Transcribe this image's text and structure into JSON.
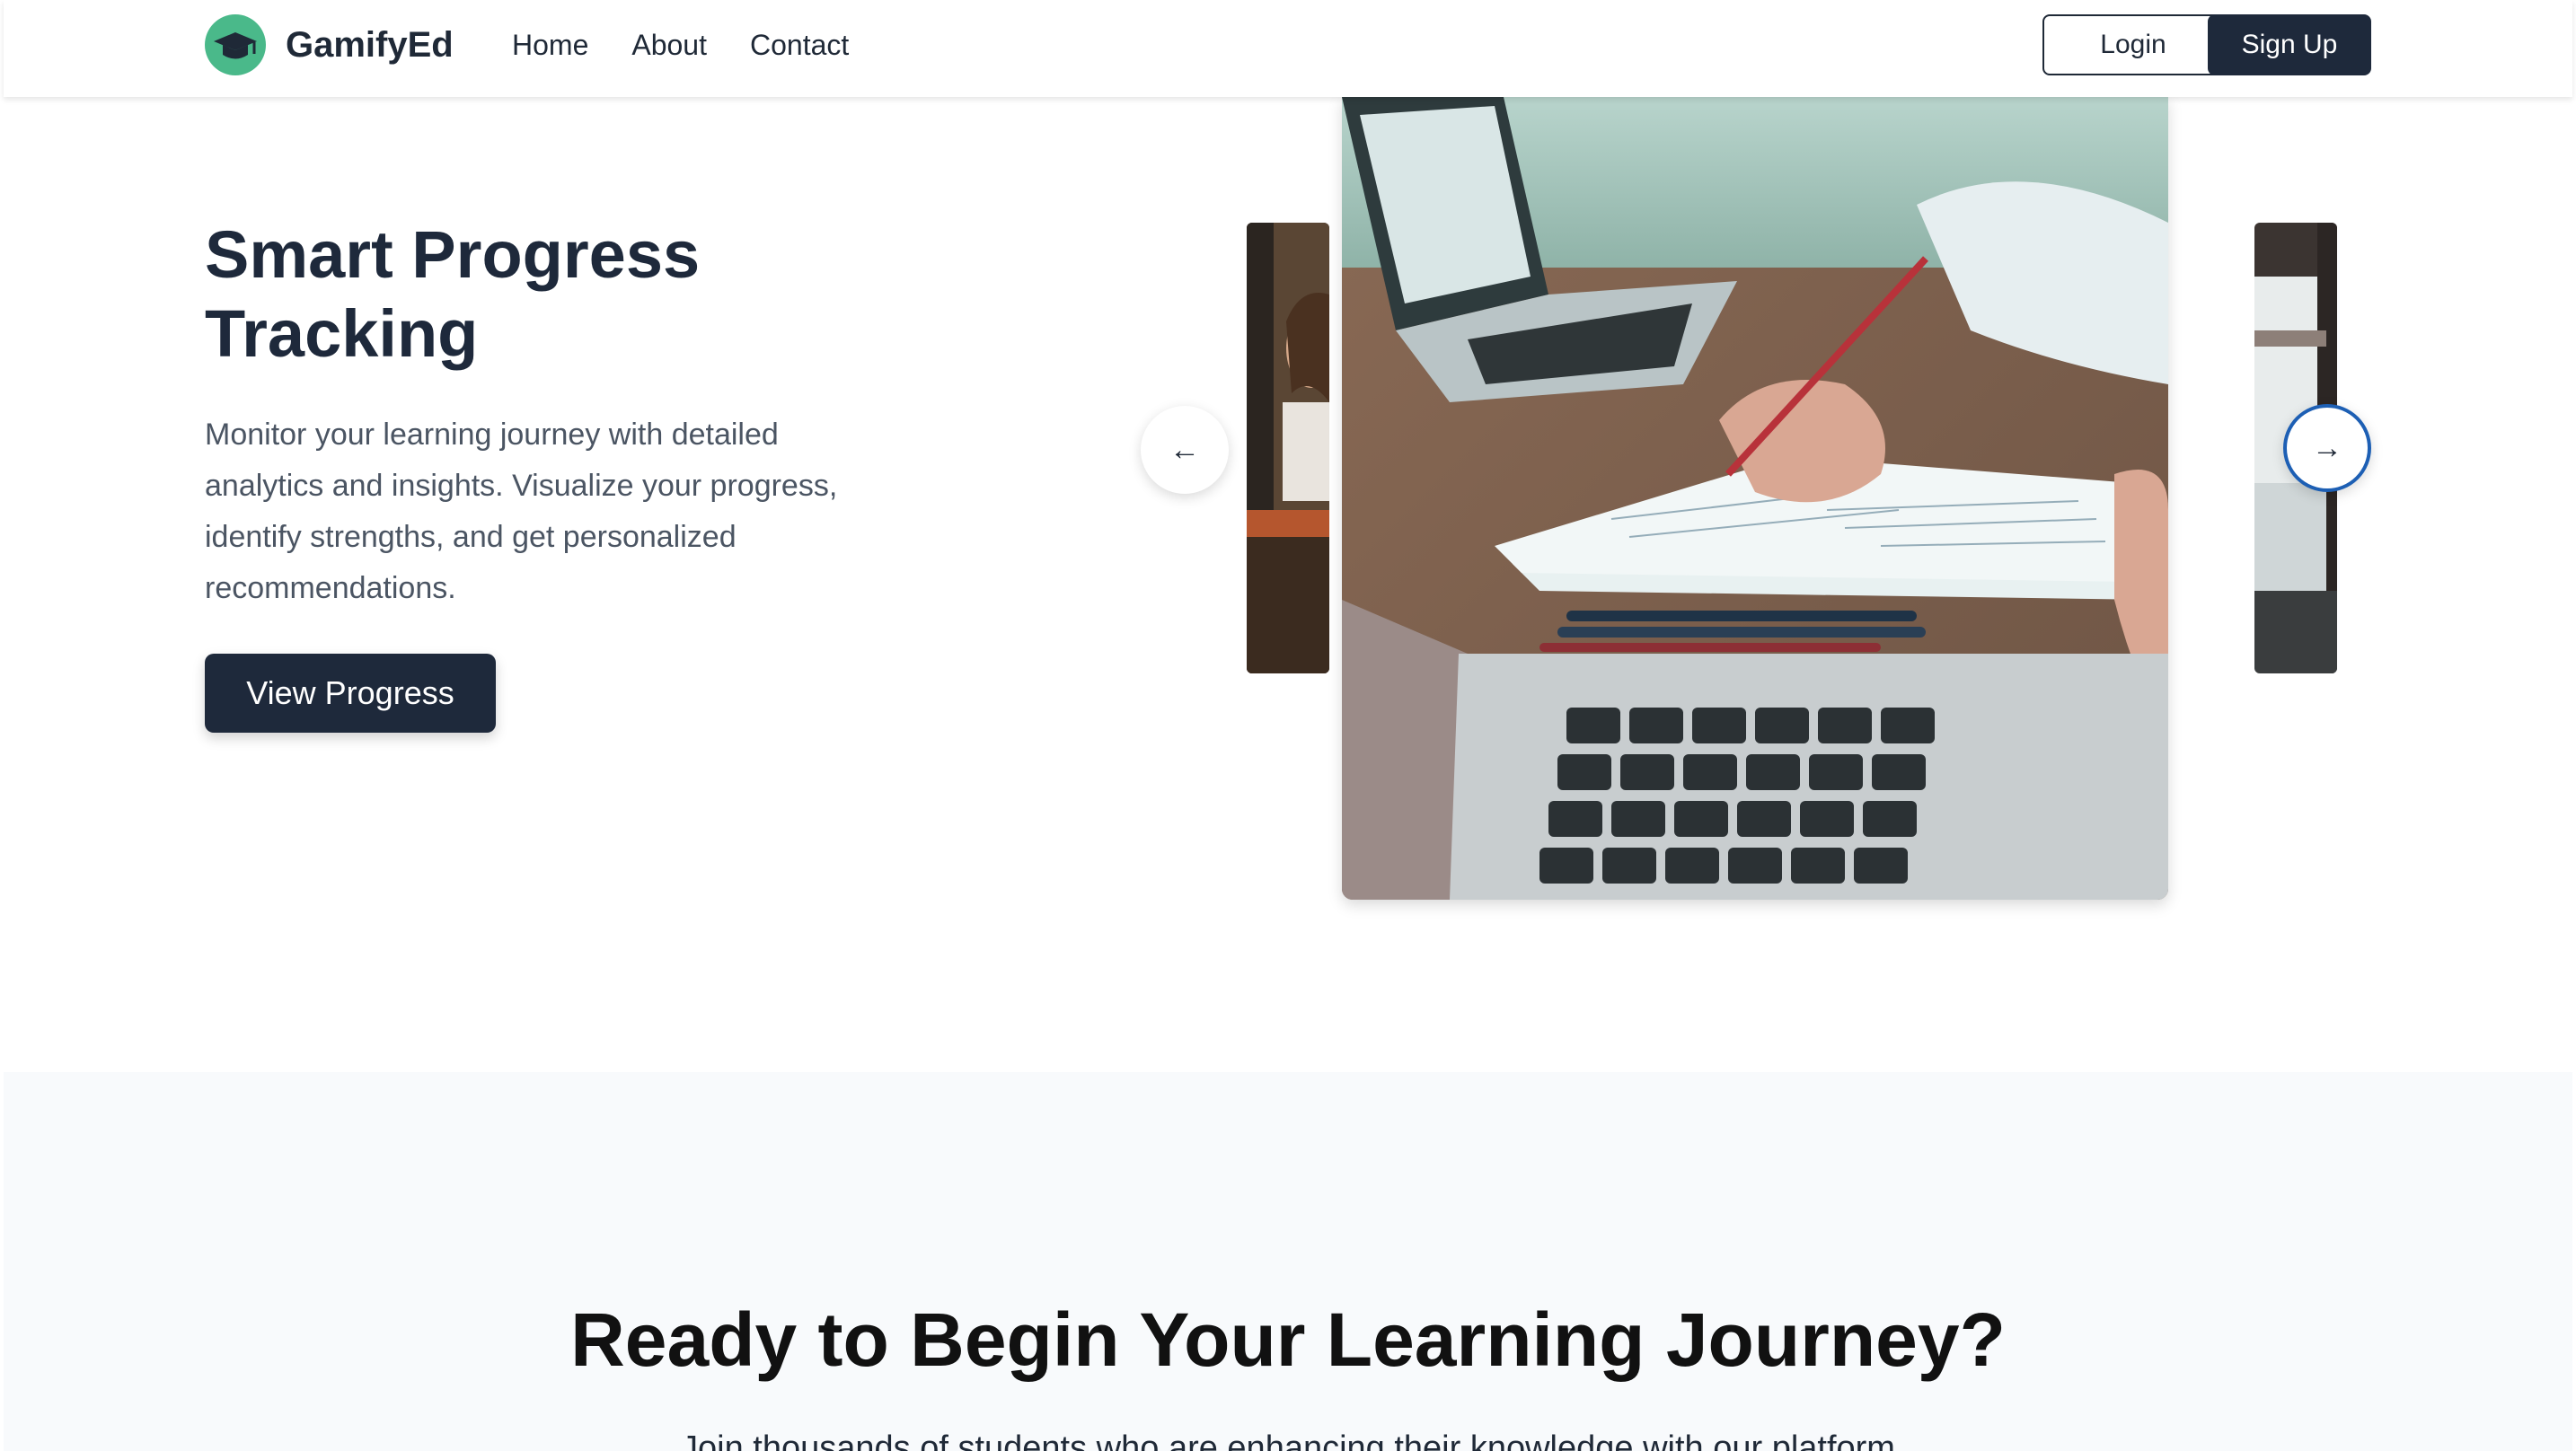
{
  "nav": {
    "brand": "GamifyEd",
    "links": [
      {
        "label": "Home"
      },
      {
        "label": "About"
      },
      {
        "label": "Contact"
      }
    ],
    "login_label": "Login",
    "signup_label": "Sign Up"
  },
  "hero": {
    "title_line1": "Smart Progress",
    "title_line2": "Tracking",
    "description": "Monitor your learning journey with detailed analytics and insights. Visualize your progress, identify strengths, and get personalized recommendations.",
    "cta_label": "View Progress"
  },
  "carousel": {
    "prev_arrow": "←",
    "next_arrow": "→"
  },
  "cta": {
    "title": "Ready to Begin Your Learning Journey?",
    "subtitle": "Join thousands of students who are enhancing their knowledge with our platform"
  },
  "colors": {
    "primary": "#1e293b",
    "logo_green": "#4ab98a",
    "focus_ring": "#1d5fb4",
    "cta_background": "#f8fafc"
  },
  "icons": {
    "logo": "graduation-cap-icon",
    "prev": "arrow-left-icon",
    "next": "arrow-right-icon"
  }
}
